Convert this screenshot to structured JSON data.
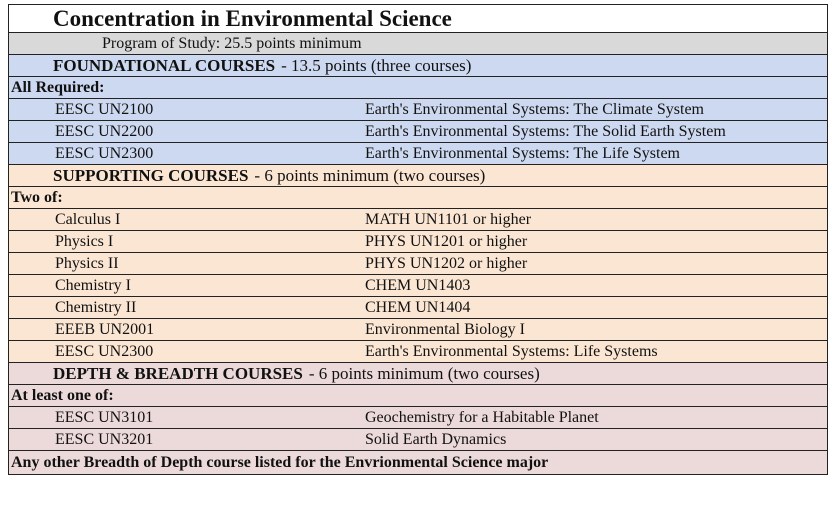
{
  "title": "Concentration in Environmental Science",
  "program": "Program of Study: 25.5 points minimum",
  "foundational": {
    "heading": "FOUNDATIONAL COURSES",
    "detail": "- 13.5 points  (three courses)",
    "sub": "All Required:",
    "items": [
      {
        "code": "EESC UN2100",
        "desc": "Earth's Environmental Systems: The Climate System"
      },
      {
        "code": "EESC UN2200",
        "desc": "Earth's Environmental Systems: The Solid Earth System"
      },
      {
        "code": "EESC UN2300",
        "desc": "Earth's Environmental Systems: The Life System"
      }
    ]
  },
  "supporting": {
    "heading": "SUPPORTING COURSES",
    "detail": "- 6 points minimum (two courses)",
    "sub": "Two of:",
    "items": [
      {
        "code": "Calculus I",
        "desc": "MATH UN1101 or higher"
      },
      {
        "code": "Physics I",
        "desc": "PHYS UN1201 or higher"
      },
      {
        "code": "Physics II",
        "desc": "PHYS UN1202 or higher"
      },
      {
        "code": "Chemistry I",
        "desc": "CHEM UN1403"
      },
      {
        "code": "Chemistry II",
        "desc": "CHEM UN1404"
      },
      {
        "code": "EEEB UN2001",
        "desc": "Environmental Biology I"
      },
      {
        "code": "EESC UN2300",
        "desc": "Earth's Environmental Systems: Life Systems"
      }
    ]
  },
  "depth": {
    "heading": "DEPTH & BREADTH COURSES",
    "detail": "- 6 points minimum (two courses)",
    "sub": "At least one of:",
    "items": [
      {
        "code": "EESC UN3101",
        "desc": "Geochemistry for a Habitable Planet"
      },
      {
        "code": "EESC UN3201",
        "desc": "Solid Earth Dynamics"
      }
    ],
    "footer": "Any other Breadth of Depth course listed  for the Envrionmental Science major"
  }
}
